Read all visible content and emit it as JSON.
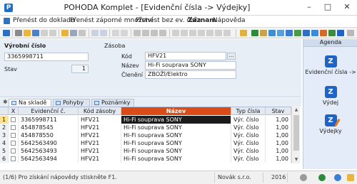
{
  "window": {
    "title": "POHODA Komplet - [Evidenční čísla -> Výdejky]",
    "app_icon": "P"
  },
  "menu": {
    "items": [
      "Přenést do dokladu",
      "Přenést záporné množství",
      "Přenést bez ev. čísla",
      "Záznam",
      "Nápověda"
    ]
  },
  "form": {
    "serial_section": "Výrobní číslo",
    "serial_value": "3365998711",
    "state_label": "Stav",
    "state_value": "1",
    "stock_section": "Zásoba",
    "code_label": "Kód",
    "code_value": "HFV21",
    "name_label": "Název",
    "name_value": "Hi-Fi souprava SONY",
    "class_label": "Členění",
    "class_value": "ZBOŽÍ/Elektro",
    "dots": "..."
  },
  "agenda": {
    "header": "Agenda",
    "items": [
      {
        "label": "Evidenční čísla ->",
        "icon": "pohoda-agenda-icon"
      },
      {
        "label": "Výdej",
        "icon": "pohoda-agenda-icon"
      },
      {
        "label": "Výdejky",
        "icon": "pohoda-agenda-edit-icon"
      }
    ]
  },
  "tabs": {
    "pin": "✱",
    "items": [
      "Na skladě",
      "Pohyby",
      "Poznámky"
    ]
  },
  "grid": {
    "columns": [
      "",
      "X",
      "Evidenční č.",
      "Kód zásoby",
      "Název",
      "Typ čísla",
      "Stav"
    ],
    "rows": [
      {
        "n": "1",
        "serial": "3365998711",
        "code": "HFV21",
        "name": "Hi-Fi souprava SONY",
        "type": "Výr. číslo",
        "state": "1,00"
      },
      {
        "n": "2",
        "serial": "454878545",
        "code": "HFV21",
        "name": "Hi-Fi souprava SONY",
        "type": "Výr. číslo",
        "state": "1,00"
      },
      {
        "n": "3",
        "serial": "454878550",
        "code": "HFV21",
        "name": "Hi-Fi souprava SONY",
        "type": "Výr. číslo",
        "state": "1,00"
      },
      {
        "n": "4",
        "serial": "5642563490",
        "code": "HFV21",
        "name": "Hi-Fi souprava SONY",
        "type": "Výr. číslo",
        "state": "1,00"
      },
      {
        "n": "5",
        "serial": "5642563493",
        "code": "HFV21",
        "name": "Hi-Fi souprava SONY",
        "type": "Výr. číslo",
        "state": "1,00"
      },
      {
        "n": "6",
        "serial": "5642563494",
        "code": "HFV21",
        "name": "Hi-Fi souprava SONY",
        "type": "Výr. číslo",
        "state": "1,00"
      }
    ]
  },
  "status": {
    "hint": "(1/6) Pro získání nápovědy stiskněte F1.",
    "company": "Novák s.r.o.",
    "year": "2016"
  },
  "colors": {
    "accent": "#d94b17",
    "agenda_blue": "#1f63c6",
    "selection": "#1b1b1b"
  }
}
